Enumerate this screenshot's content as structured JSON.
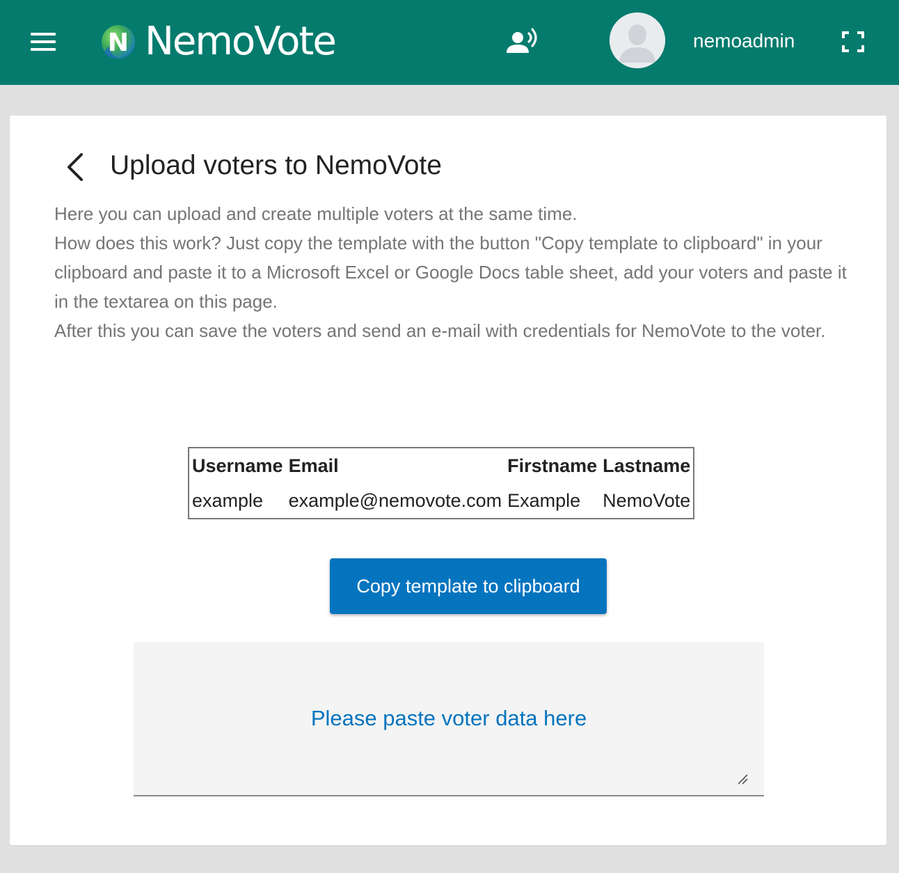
{
  "header": {
    "menu_icon": "hamburger-menu-icon",
    "logo_text": "NemoVote",
    "logo_letter": "N",
    "presenter_icon": "record-voice-over-icon",
    "avatar_icon": "default-user-avatar-icon",
    "username": "nemoadmin",
    "fullscreen_icon": "fullscreen-icon",
    "colors": {
      "bar_background": "#047b6d",
      "foreground": "#ffffff"
    }
  },
  "page": {
    "back_icon": "chevron-left-icon",
    "title": "Upload voters to NemoVote",
    "intro": [
      "Here you can upload and create multiple voters at the same time.",
      "How does this work? Just copy the template with the button \"Copy template to clipboard\" in your clipboard and paste it to a Microsoft Excel or Google Docs table sheet, add your voters and paste it in the textarea on this page.",
      "After this you can save the voters and send an e-mail with credentials for NemoVote to the voter."
    ]
  },
  "template_table": {
    "headers": [
      "Username",
      "Email",
      "Firstname",
      "Lastname"
    ],
    "rows": [
      [
        "example",
        "example@nemovote.com",
        "Example",
        "NemoVote"
      ]
    ]
  },
  "copy_button": {
    "label": "Copy template to clipboard",
    "color": "#0574bf"
  },
  "paste_area": {
    "placeholder": "Please paste voter data here",
    "value": "",
    "resize_icon": "resize-grip-icon"
  }
}
